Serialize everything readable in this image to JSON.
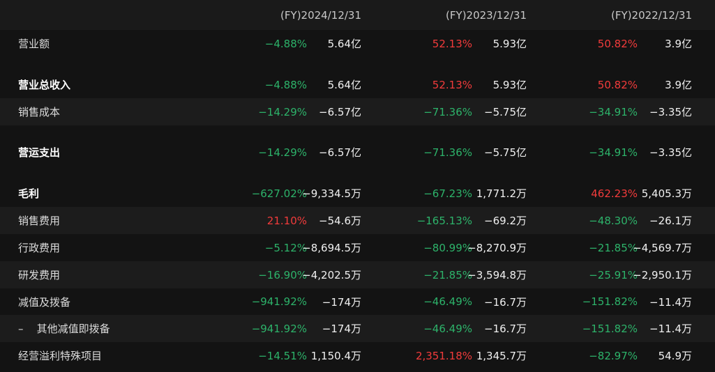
{
  "columns": [
    "(FY)2024/12/31",
    "(FY)2023/12/31",
    "(FY)2022/12/31"
  ],
  "colors": {
    "positive": "#f23b3b",
    "negative": "#2db36a",
    "background": "#131313",
    "row_alt": "#1c1c1c"
  },
  "rows": [
    {
      "label": "营业额",
      "bold": false,
      "cells": [
        {
          "pct": "−4.88%",
          "val": "5.64亿",
          "sign": "neg"
        },
        {
          "pct": "52.13%",
          "val": "5.93亿",
          "sign": "pos"
        },
        {
          "pct": "50.82%",
          "val": "3.9亿",
          "sign": "pos"
        }
      ]
    },
    {
      "label": "营业总收入",
      "bold": true,
      "cells": [
        {
          "pct": "−4.88%",
          "val": "5.64亿",
          "sign": "neg"
        },
        {
          "pct": "52.13%",
          "val": "5.93亿",
          "sign": "pos"
        },
        {
          "pct": "50.82%",
          "val": "3.9亿",
          "sign": "pos"
        }
      ]
    },
    {
      "label": "销售成本",
      "bold": false,
      "cells": [
        {
          "pct": "−14.29%",
          "val": "−6.57亿",
          "sign": "neg"
        },
        {
          "pct": "−71.36%",
          "val": "−5.75亿",
          "sign": "neg"
        },
        {
          "pct": "−34.91%",
          "val": "−3.35亿",
          "sign": "neg"
        }
      ]
    },
    {
      "label": "营运支出",
      "bold": true,
      "cells": [
        {
          "pct": "−14.29%",
          "val": "−6.57亿",
          "sign": "neg"
        },
        {
          "pct": "−71.36%",
          "val": "−5.75亿",
          "sign": "neg"
        },
        {
          "pct": "−34.91%",
          "val": "−3.35亿",
          "sign": "neg"
        }
      ]
    },
    {
      "label": "毛利",
      "bold": true,
      "cells": [
        {
          "pct": "−627.02%",
          "val": "−9,334.5万",
          "sign": "neg"
        },
        {
          "pct": "−67.23%",
          "val": "1,771.2万",
          "sign": "neg"
        },
        {
          "pct": "462.23%",
          "val": "5,405.3万",
          "sign": "pos"
        }
      ]
    },
    {
      "label": "销售费用",
      "bold": false,
      "cells": [
        {
          "pct": "21.10%",
          "val": "−54.6万",
          "sign": "pos"
        },
        {
          "pct": "−165.13%",
          "val": "−69.2万",
          "sign": "neg"
        },
        {
          "pct": "−48.30%",
          "val": "−26.1万",
          "sign": "neg"
        }
      ]
    },
    {
      "label": "行政费用",
      "bold": false,
      "cells": [
        {
          "pct": "−5.12%",
          "val": "−8,694.5万",
          "sign": "neg"
        },
        {
          "pct": "−80.99%",
          "val": "−8,270.9万",
          "sign": "neg"
        },
        {
          "pct": "−21.85%",
          "val": "−4,569.7万",
          "sign": "neg"
        }
      ]
    },
    {
      "label": "研发费用",
      "bold": false,
      "cells": [
        {
          "pct": "−16.90%",
          "val": "−4,202.5万",
          "sign": "neg"
        },
        {
          "pct": "−21.85%",
          "val": "−3,594.8万",
          "sign": "neg"
        },
        {
          "pct": "−25.91%",
          "val": "−2,950.1万",
          "sign": "neg"
        }
      ]
    },
    {
      "label": "减值及拨备",
      "bold": false,
      "cells": [
        {
          "pct": "−941.92%",
          "val": "−174万",
          "sign": "neg"
        },
        {
          "pct": "−46.49%",
          "val": "−16.7万",
          "sign": "neg"
        },
        {
          "pct": "−151.82%",
          "val": "−11.4万",
          "sign": "neg"
        }
      ]
    },
    {
      "label": "–    其他减值即拨备",
      "bold": false,
      "cells": [
        {
          "pct": "−941.92%",
          "val": "−174万",
          "sign": "neg"
        },
        {
          "pct": "−46.49%",
          "val": "−16.7万",
          "sign": "neg"
        },
        {
          "pct": "−151.82%",
          "val": "−11.4万",
          "sign": "neg"
        }
      ]
    },
    {
      "label": "经营溢利特殊项目",
      "bold": false,
      "cells": [
        {
          "pct": "−14.51%",
          "val": "1,150.4万",
          "sign": "neg"
        },
        {
          "pct": "2,351.18%",
          "val": "1,345.7万",
          "sign": "pos"
        },
        {
          "pct": "−82.97%",
          "val": "54.9万",
          "sign": "neg"
        }
      ]
    }
  ]
}
